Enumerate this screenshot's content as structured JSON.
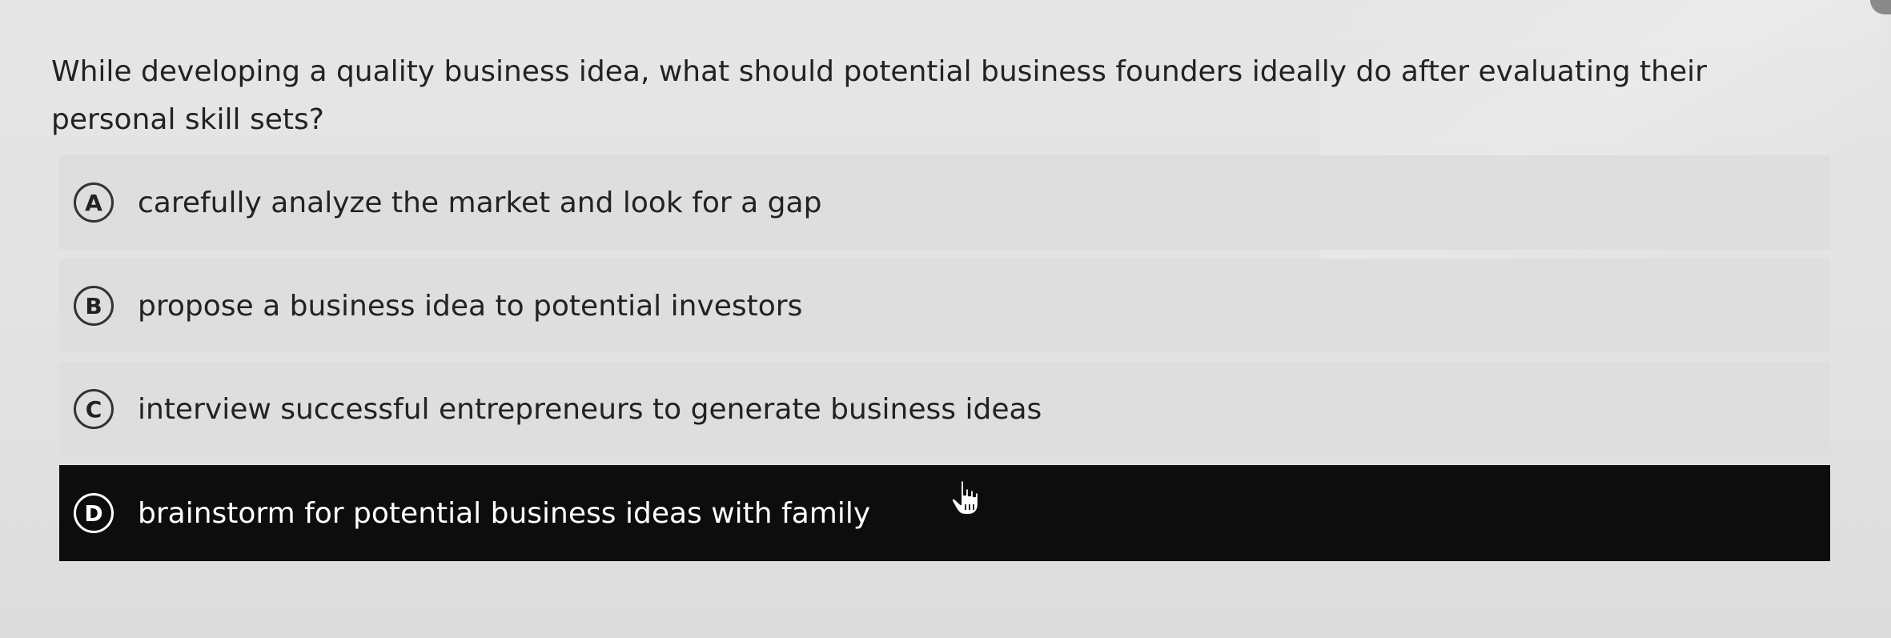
{
  "question": {
    "text": "While developing a quality business idea, what should potential business founders ideally do after evaluating their personal skill sets?"
  },
  "options": [
    {
      "letter": "A",
      "text": "carefully analyze the market and look for a gap",
      "selected": false
    },
    {
      "letter": "B",
      "text": "propose a business idea to potential investors",
      "selected": false
    },
    {
      "letter": "C",
      "text": "interview successful entrepreneurs to generate business ideas",
      "selected": false
    },
    {
      "letter": "D",
      "text": "brainstorm for potential business ideas with family",
      "selected": true
    }
  ],
  "icons": {
    "cursor": "hand-pointer-icon"
  },
  "colors": {
    "selected_background": "#0d0d0d",
    "option_background": "#dedede",
    "page_background": "#e4e4e4",
    "text": "#222222"
  }
}
